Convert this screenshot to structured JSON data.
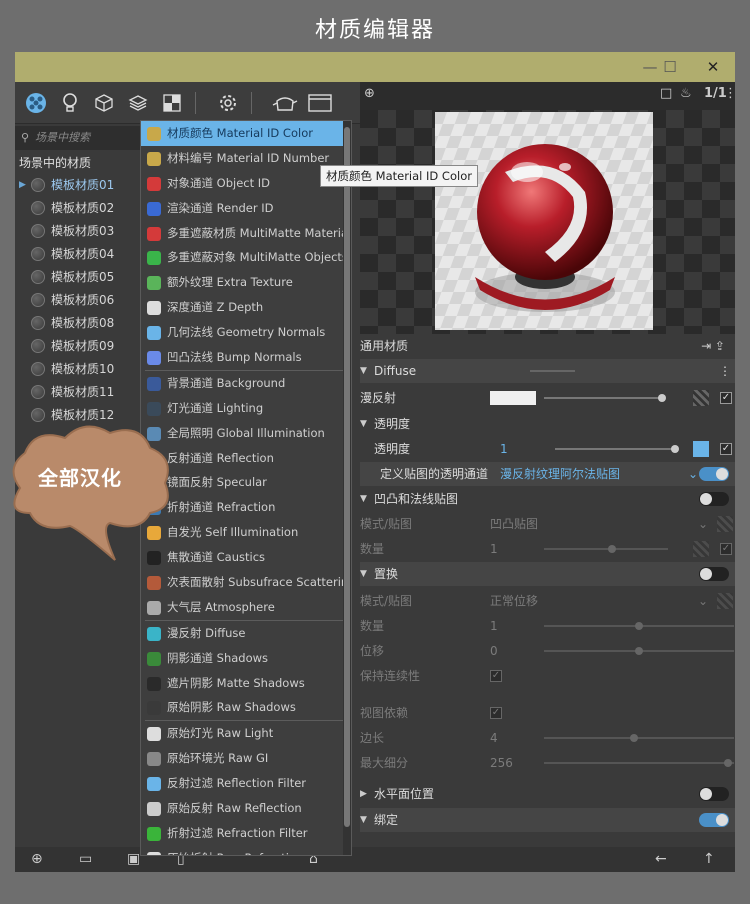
{
  "page_title": "材质编辑器",
  "window": {
    "minimize": "—",
    "maximize": "☐",
    "close": "✕"
  },
  "search_placeholder": "场景中搜索",
  "scene_materials_label": "场景中的材质",
  "materials": [
    "模板材质01",
    "模板材质02",
    "模板材质03",
    "模板材质04",
    "模板材质05",
    "模板材质06",
    "模板材质08",
    "模板材质09",
    "模板材质10",
    "模板材质11",
    "模板材质12"
  ],
  "dropdown_items": [
    {
      "label": "材质颜色 Material ID Color",
      "color": "#c8a84a"
    },
    {
      "label": "材料编号 Material ID Number",
      "color": "#c8a84a"
    },
    {
      "label": "对象通道 Object ID",
      "color": "#d43a3a"
    },
    {
      "label": "渲染通道 Render ID",
      "color": "#3a6ad4"
    },
    {
      "label": "多重遮蔽材质 MultiMatte Materials",
      "color": "#d43a3a"
    },
    {
      "label": "多重遮蔽对象 MultiMatte Objects",
      "color": "#3ab44a"
    },
    {
      "label": "额外纹理 Extra Texture",
      "color": "#5ab45a"
    },
    {
      "label": "深度通道 Z Depth",
      "color": "#dddddd"
    },
    {
      "label": "几何法线 Geometry Normals",
      "color": "#6ab4e8"
    },
    {
      "label": "凹凸法线 Bump Normals",
      "color": "#6a8ae8"
    },
    {
      "label": "背景通道 Background",
      "color": "#3a5a9a"
    },
    {
      "label": "灯光通道 Lighting",
      "color": "#3a4a5a"
    },
    {
      "label": "全局照明 Global Illumination",
      "color": "#5a8ab4"
    },
    {
      "label": "反射通道 Reflection",
      "color": "#4a6a8a"
    },
    {
      "label": "镜面反射 Specular",
      "color": "#6a6a6a"
    },
    {
      "label": "折射通道 Refraction",
      "color": "#3a7ab4"
    },
    {
      "label": "自发光 Self Illumination",
      "color": "#e8a83a"
    },
    {
      "label": "焦散通道 Caustics",
      "color": "#222222"
    },
    {
      "label": "次表面散射 Subsufrace Scattering",
      "color": "#b45a3a"
    },
    {
      "label": "大气层 Atmosphere",
      "color": "#aaaaaa"
    },
    {
      "label": "漫反射 Diffuse",
      "color": "#3ab4c8"
    },
    {
      "label": "阴影通道 Shadows",
      "color": "#3a8a3a"
    },
    {
      "label": "遮片阴影 Matte Shadows",
      "color": "#2a2a2a"
    },
    {
      "label": "原始阴影 Raw Shadows",
      "color": "#3a3a3a"
    },
    {
      "label": "原始灯光 Raw Light",
      "color": "#dddddd"
    },
    {
      "label": "原始环境光 Raw GI",
      "color": "#888888"
    },
    {
      "label": "反射过滤 Reflection Filter",
      "color": "#6ab4e8"
    },
    {
      "label": "原始反射 Raw Reflection",
      "color": "#cccccc"
    },
    {
      "label": "折射过滤 Refraction Filter",
      "color": "#3ab43a"
    },
    {
      "label": "原始折射 Raw Refraction",
      "color": "#dddddd"
    }
  ],
  "tooltip": "材质颜色 Material ID Color",
  "preview_counter": "1/1",
  "props": {
    "general": "通用材质",
    "diffuse_section": "Diffuse",
    "diffuse_label": "漫反射",
    "transparency_section": "透明度",
    "transparency_label": "透明度",
    "transparency_value": "1",
    "custom_map_label": "定义贴图的透明通道",
    "custom_map_value": "漫反射纹理阿尔法贴图",
    "bump_section": "凹凸和法线贴图",
    "bump_mode_label": "模式/贴图",
    "bump_mode_value": "凹凸贴图",
    "bump_amount_label": "数量",
    "bump_amount_value": "1",
    "displacement_section": "置换",
    "disp_mode_label": "模式/贴图",
    "disp_mode_value": "正常位移",
    "disp_amount_label": "数量",
    "disp_amount_value": "1",
    "disp_shift_label": "位移",
    "disp_shift_value": "0",
    "keep_continuity_label": "保持连续性",
    "view_dependent_label": "视图依赖",
    "edge_length_label": "边长",
    "edge_length_value": "4",
    "max_subdiv_label": "最大细分",
    "max_subdiv_value": "256",
    "water_level_section": "水平面位置",
    "binding_section": "绑定"
  },
  "callout": "全部汉化"
}
